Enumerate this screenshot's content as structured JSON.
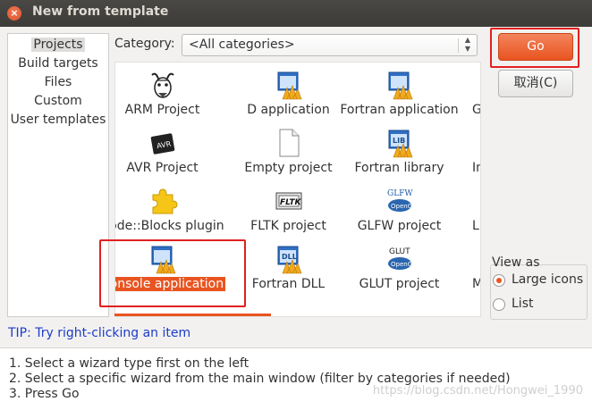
{
  "window": {
    "title": "New from template",
    "close_glyph": "×"
  },
  "left_nav": {
    "items": [
      "Projects",
      "Build targets",
      "Files",
      "Custom",
      "User templates"
    ],
    "selected": "Projects"
  },
  "category": {
    "label": "Category:",
    "value": "<All categories>"
  },
  "templates": [
    {
      "label": "ARM Project",
      "icon": "gnu-icon"
    },
    {
      "label": "D application",
      "icon": "app-window-icon"
    },
    {
      "label": "Fortran application",
      "icon": "app-window-icon"
    },
    {
      "label": "G",
      "icon": ""
    },
    {
      "label": "AVR Project",
      "icon": "avr-chip-icon"
    },
    {
      "label": "Empty project",
      "icon": "blank-document-icon"
    },
    {
      "label": "Fortran library",
      "icon": "lib-icon"
    },
    {
      "label": "In",
      "icon": ""
    },
    {
      "label": "Code::Blocks plugin",
      "icon": "puzzle-piece-icon"
    },
    {
      "label": "FLTK project",
      "icon": "fltk-icon"
    },
    {
      "label": "GLFW project",
      "icon": "glfw-opengl-icon"
    },
    {
      "label": "Li",
      "icon": ""
    },
    {
      "label": "Console application",
      "icon": "app-window-icon",
      "selected": true
    },
    {
      "label": "Fortran DLL",
      "icon": "dll-icon"
    },
    {
      "label": "GLUT project",
      "icon": "glut-opengl-icon"
    },
    {
      "label": "M",
      "icon": ""
    }
  ],
  "buttons": {
    "go": "Go",
    "cancel": "取消(C)"
  },
  "view_as": {
    "legend": "View as",
    "options": [
      "Large icons",
      "List"
    ],
    "selected": "Large icons"
  },
  "tip": "TIP: Try right-clicking an item",
  "instructions": [
    "1. Select a wizard type first on the left",
    "2. Select a specific wizard from the main window (filter by categories if needed)",
    "3. Press Go"
  ],
  "watermark": "https://blog.csdn.net/Hongwei_1990",
  "colors": {
    "accent": "#e95420",
    "highlight_box": "#e12020",
    "tip_text": "#1c3cc8"
  }
}
